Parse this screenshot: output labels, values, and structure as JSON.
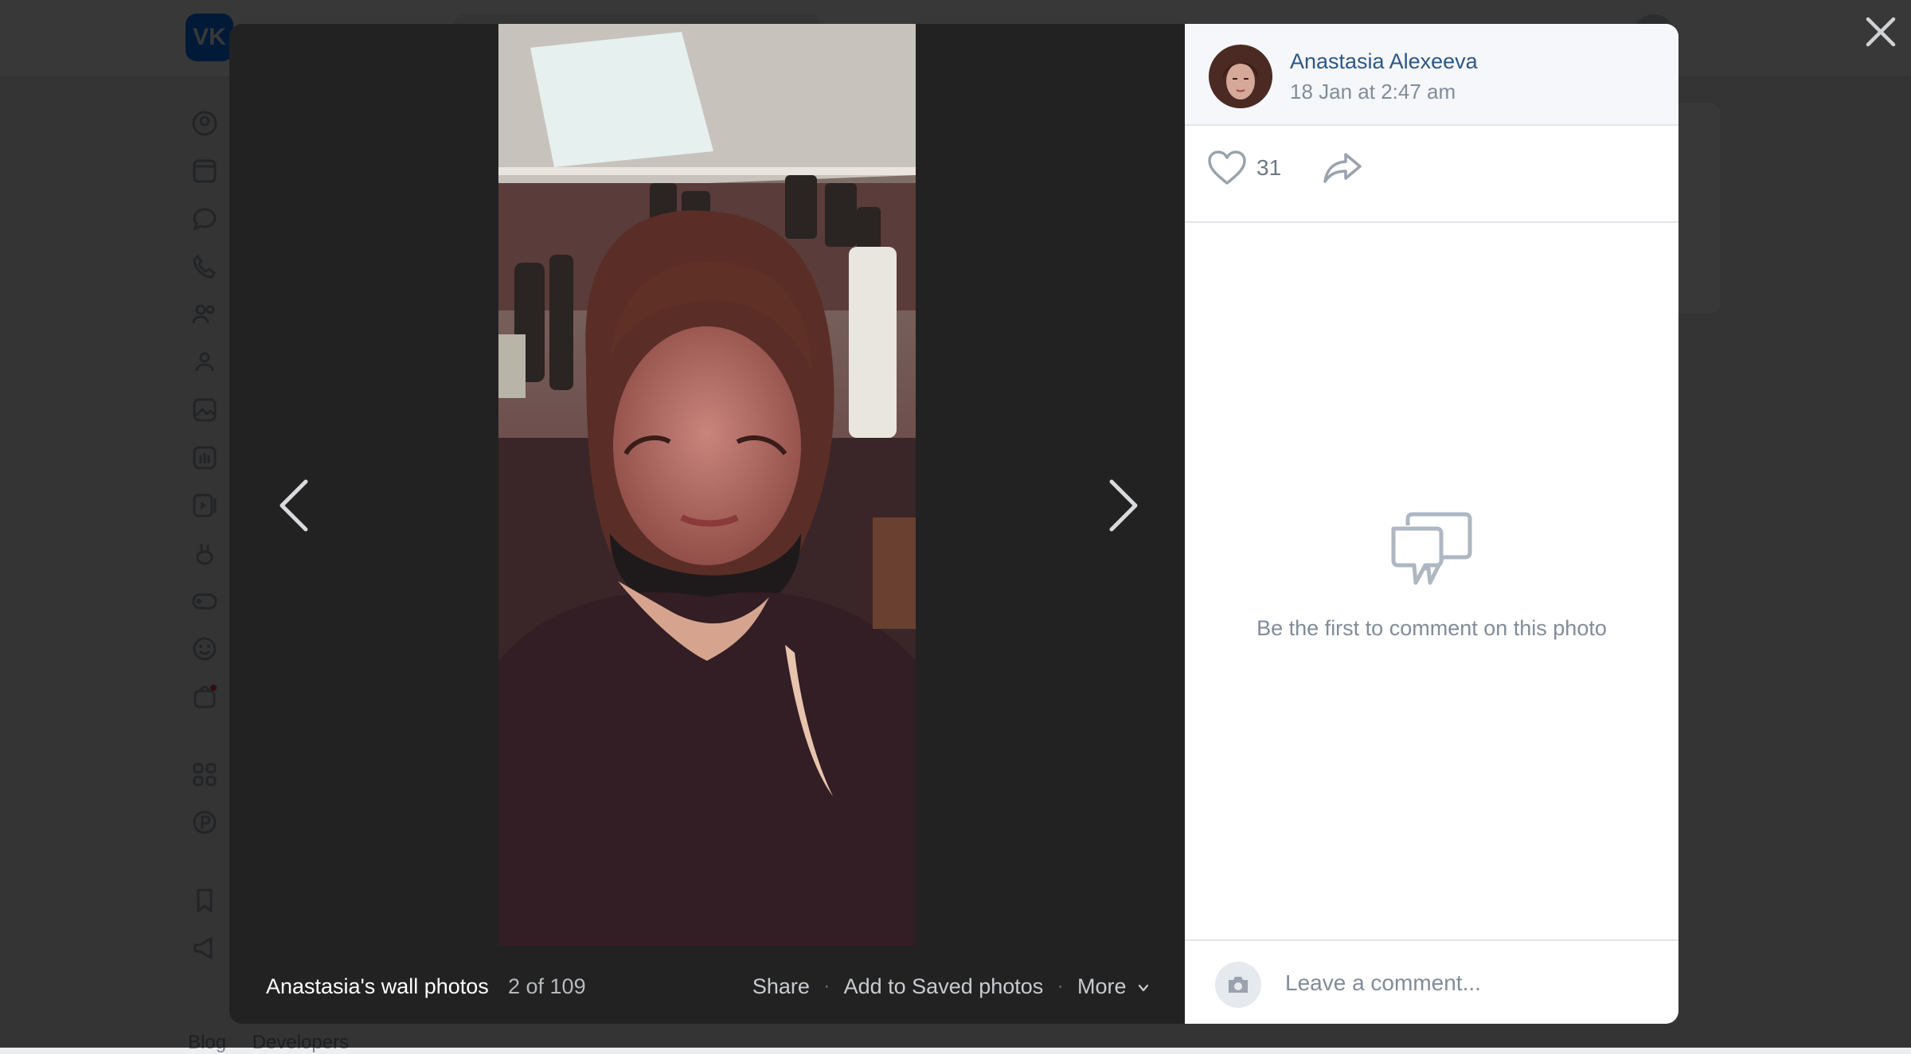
{
  "background": {
    "logo_text": "VK",
    "footer_links": [
      "Blog",
      "Developers"
    ]
  },
  "viewer": {
    "album_title": "Anastasia's wall photos",
    "counter": "2 of 109",
    "actions": {
      "share": "Share",
      "save": "Add to Saved photos",
      "more": "More",
      "separator": "·"
    }
  },
  "post": {
    "author_name": "Anastasia Alexeeva",
    "date": "18 Jan at 2:47 am",
    "likes": "31"
  },
  "comments": {
    "empty_text": "Be the first to comment on this photo",
    "input_placeholder": "Leave a comment..."
  },
  "colors": {
    "accent": "#0077ff",
    "author_link": "#2c5787",
    "muted": "#818c99"
  },
  "icons": [
    "close-icon",
    "chevron-left-icon",
    "chevron-right-icon",
    "heart-icon",
    "share-arrow-icon",
    "comments-icon",
    "camera-icon",
    "chevron-down-icon"
  ]
}
